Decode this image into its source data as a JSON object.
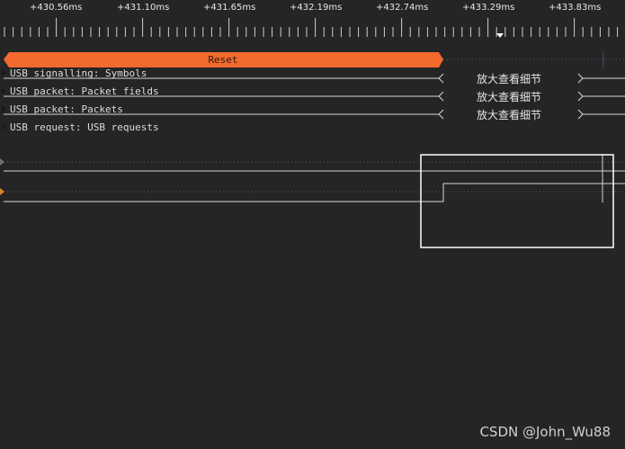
{
  "timeline": {
    "ticks": [
      "+430.56ms",
      "+431.10ms",
      "+431.65ms",
      "+432.19ms",
      "+432.74ms",
      "+433.29ms",
      "+433.83ms"
    ]
  },
  "reset_bar": {
    "label": "Reset",
    "color": "#f26a2e"
  },
  "rows": [
    {
      "label": "USB signalling: Symbols",
      "zoom_text": "放大查看细节"
    },
    {
      "label": "USB packet: Packet fields",
      "zoom_text": "放大查看细节"
    },
    {
      "label": "USB packet: Packets",
      "zoom_text": "放大查看细节"
    },
    {
      "label": "USB request: USB requests"
    }
  ],
  "watermark": "CSDN @John_Wu88",
  "colors": {
    "background": "#252525",
    "trace": "#d8d8d8",
    "accent": "#f26a2e"
  }
}
